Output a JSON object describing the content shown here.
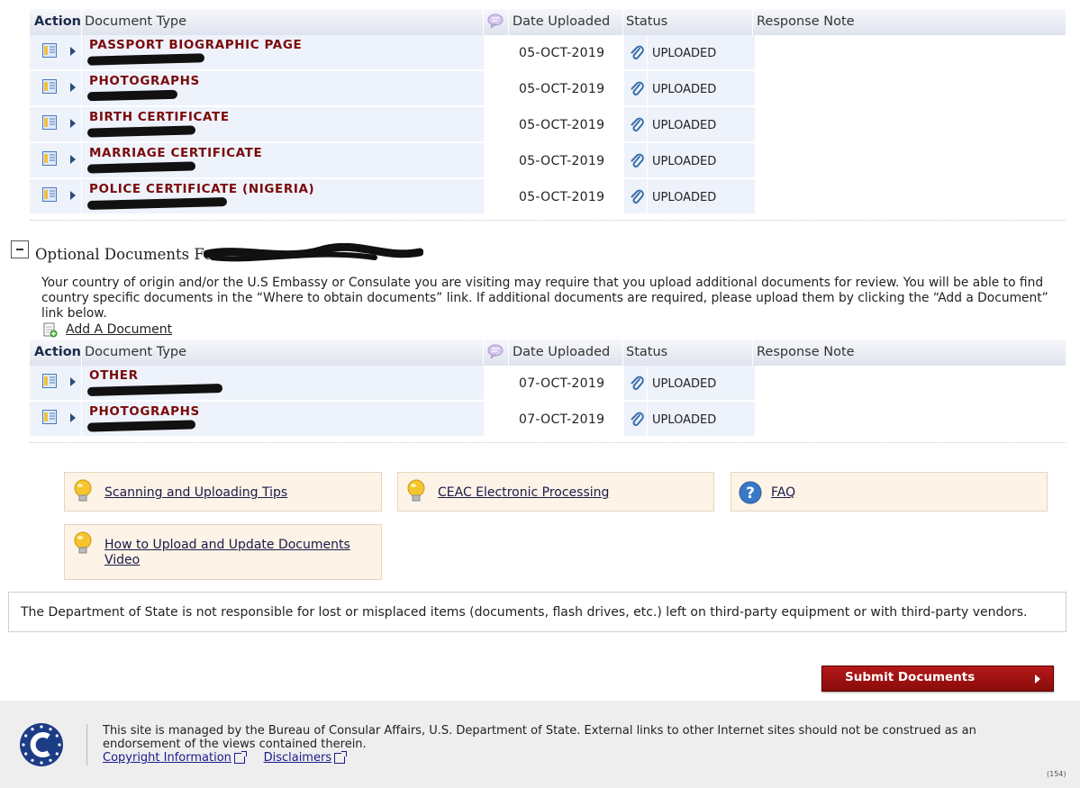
{
  "required_table": {
    "headers": {
      "action": "Action",
      "document_type": "Document Type",
      "date_uploaded": "Date Uploaded",
      "status": "Status",
      "response_note": "Response Note"
    },
    "rows": [
      {
        "document_type": "PASSPORT BIOGRAPHIC PAGE",
        "date": "05-OCT-2019",
        "status": "UPLOADED"
      },
      {
        "document_type": "PHOTOGRAPHS",
        "date": "05-OCT-2019",
        "status": "UPLOADED"
      },
      {
        "document_type": "BIRTH CERTIFICATE",
        "date": "05-OCT-2019",
        "status": "UPLOADED"
      },
      {
        "document_type": "MARRIAGE CERTIFICATE",
        "date": "05-OCT-2019",
        "status": "UPLOADED"
      },
      {
        "document_type": "POLICE CERTIFICATE (NIGERIA)",
        "date": "05-OCT-2019",
        "status": "UPLOADED"
      }
    ]
  },
  "optional_section": {
    "title": "Optional Documents For",
    "description": "Your country of origin and/or the U.S Embassy or Consulate you are visiting may require that you upload additional documents for review. You will be able to find country specific documents in the “Where to obtain documents” link. If additional documents are required, please upload them by clicking the “Add a Document” link below.",
    "add_link": "Add A Document"
  },
  "optional_table": {
    "headers": {
      "action": "Action",
      "document_type": "Document Type",
      "date_uploaded": "Date Uploaded",
      "status": "Status",
      "response_note": "Response Note"
    },
    "rows": [
      {
        "document_type": "OTHER",
        "date": "07-OCT-2019",
        "status": "UPLOADED"
      },
      {
        "document_type": "PHOTOGRAPHS",
        "date": "07-OCT-2019",
        "status": "UPLOADED"
      }
    ]
  },
  "help_links": {
    "scanning_tips": "Scanning and Uploading Tips",
    "electronic_processing": "CEAC Electronic Processing",
    "faq": "FAQ",
    "upload_video": "How to Upload and Update Documents Video"
  },
  "notice": "The Department of State is not responsible for lost or misplaced items (documents, flash drives, etc.) left on third-party equipment or with third-party vendors.",
  "submit_label": "Submit Documents",
  "footer": {
    "text": "This site is managed by the Bureau of Consular Affairs, U.S. Department of State. External links to other Internet sites should not be construed as an endorsement of the views contained therein.",
    "copyright_link": "Copyright Information",
    "disclaimers_link": "Disclaimers",
    "page_number": "(154)"
  },
  "colors": {
    "doc_title": "#7a0a0a",
    "submit_bg": "#a31212",
    "tip_bg": "#fdf3e7",
    "row_bg": "#eef2fb"
  }
}
